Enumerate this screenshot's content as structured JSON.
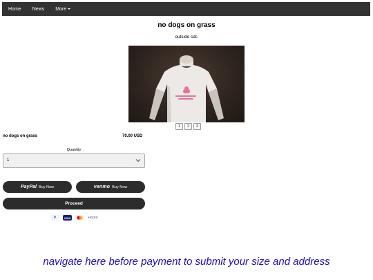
{
  "nav": {
    "items": [
      {
        "label": "Home"
      },
      {
        "label": "News"
      },
      {
        "label": "More"
      }
    ]
  },
  "product": {
    "title": "no dogs on grass",
    "subtitle": "outside cat.",
    "name": "no dogs on grass",
    "price": "70.00 USD",
    "image_icon": "t-shirt-photo"
  },
  "gallery": {
    "pages": [
      "1",
      "2",
      "3"
    ]
  },
  "quantity": {
    "label": "Quantity",
    "value": "1"
  },
  "payment": {
    "paypal_brand": "PayPal",
    "paypal_label": "Buy Now",
    "venmo_brand": "venmo",
    "venmo_label": "Buy Now",
    "proceed_label": "Proceed",
    "marks": [
      "P",
      "VISA"
    ],
    "more_label": "+more"
  },
  "notice": {
    "text": "navigate here before payment to submit your size and address"
  },
  "colors": {
    "navbar": "#333333",
    "button": "#2c2c2c",
    "link": "#1a0db0"
  }
}
